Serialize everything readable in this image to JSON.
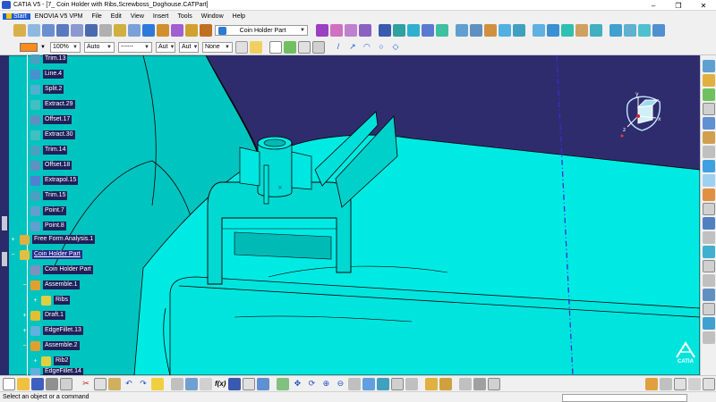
{
  "window": {
    "title": "CATIA V5 - [7_ Coin Holder with Ribs,Screwboss_Doghouse.CATPart]",
    "minimize": "–",
    "maximize": "❐",
    "close": "✕"
  },
  "menu": {
    "start": "Start",
    "items": [
      "ENOVIA V5 VPM",
      "File",
      "Edit",
      "View",
      "Insert",
      "Tools",
      "Window",
      "Help"
    ]
  },
  "toolbar": {
    "part_combo": "Coin Holder Part",
    "zoom_combo": "100%",
    "auto_combo": "Auto",
    "line_combo": "------",
    "aut_combo1": "Aut",
    "aut_combo2": "Aut",
    "none_combo": "None",
    "fill_color": "#ff8a1c"
  },
  "tree": {
    "items": [
      {
        "label": "Trim.13",
        "icon": "trim-icon",
        "highlight": false
      },
      {
        "label": "Line.4",
        "icon": "line-icon",
        "highlight": false
      },
      {
        "label": "Split.2",
        "icon": "split-icon",
        "highlight": false
      },
      {
        "label": "Extract.29",
        "icon": "extract-icon",
        "highlight": false
      },
      {
        "label": "Offset.17",
        "icon": "offset-icon",
        "highlight": false
      },
      {
        "label": "Extract.30",
        "icon": "extract-icon",
        "highlight": false
      },
      {
        "label": "Trim.14",
        "icon": "trim-icon",
        "highlight": false
      },
      {
        "label": "Offset.18",
        "icon": "offset-icon",
        "highlight": false
      },
      {
        "label": "Extrapol.15",
        "icon": "extrapol-icon",
        "highlight": false
      },
      {
        "label": "Trim.15",
        "icon": "trim-icon",
        "highlight": false
      },
      {
        "label": "Point.7",
        "icon": "point-icon",
        "highlight": false
      },
      {
        "label": "Point.8",
        "icon": "point-icon",
        "highlight": false
      },
      {
        "label": "Free Form Analysis.1",
        "icon": "analysis-icon",
        "highlight": false
      },
      {
        "label": "Coin Holder Part",
        "icon": "part-icon",
        "highlight": true
      },
      {
        "label": "Coin Holder Part",
        "icon": "body-icon",
        "highlight": false
      },
      {
        "label": "Assemble.1",
        "icon": "assemble-icon",
        "highlight": false
      },
      {
        "label": "Ribs",
        "icon": "ribs-icon",
        "highlight": false
      },
      {
        "label": "Draft.1",
        "icon": "draft-icon",
        "highlight": false
      },
      {
        "label": "EdgeFillet.13",
        "icon": "fillet-icon",
        "highlight": false
      },
      {
        "label": "Assemble.2",
        "icon": "assemble-icon",
        "highlight": false
      },
      {
        "label": "Rib2",
        "icon": "ribs-icon",
        "highlight": false
      },
      {
        "label": "EdgeFillet.14",
        "icon": "fillet-icon",
        "highlight": false
      }
    ]
  },
  "compass": {
    "x": "x",
    "y": "y",
    "z": "z"
  },
  "colors": {
    "background": "#2f2c6e",
    "surface": "#00e6e0",
    "surface_dark": "#00b8b4",
    "edge": "#000000",
    "axis_line": "#3a2bd0"
  },
  "bottom": {
    "fx": "f(x)"
  },
  "status": {
    "message": "Select an object or a command"
  },
  "logo": {
    "label": "CATIA"
  }
}
